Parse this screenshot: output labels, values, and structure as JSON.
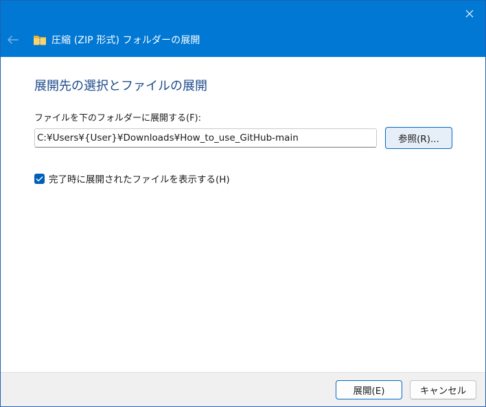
{
  "window": {
    "title": "圧縮 (ZIP 形式) フォルダーの展開",
    "accent_color": "#0078d4",
    "icons": {
      "back": "back-arrow-icon",
      "folder": "zip-folder-icon",
      "close": "close-icon"
    }
  },
  "main": {
    "heading": "展開先の選択とファイルの展開",
    "destination_label": "ファイルを下のフォルダーに展開する(F):",
    "destination_value": "C:¥Users¥{User}¥Downloads¥How_to_use_GitHub-main",
    "browse_label": "参照(R)...",
    "show_files_checkbox": {
      "label": "完了時に展開されたファイルを表示する(H)",
      "checked": true
    }
  },
  "footer": {
    "extract_label": "展開(E)",
    "cancel_label": "キャンセル"
  }
}
